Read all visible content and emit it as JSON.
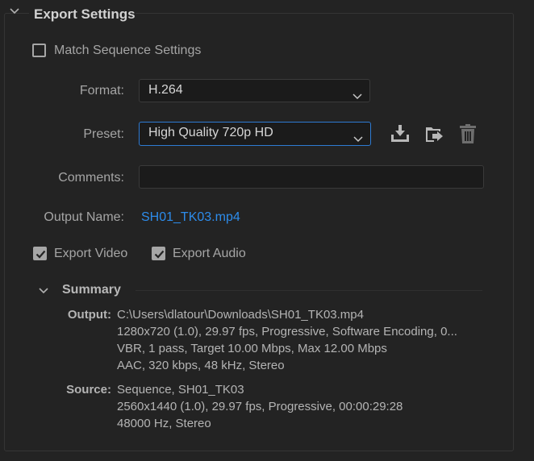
{
  "header": {
    "title": "Export Settings"
  },
  "match_sequence": {
    "label": "Match Sequence Settings",
    "checked": false
  },
  "format": {
    "label": "Format:",
    "value": "H.264"
  },
  "preset": {
    "label": "Preset:",
    "value": "High Quality 720p HD"
  },
  "preset_actions": [
    "save-preset-icon",
    "import-preset-icon",
    "delete-preset-icon"
  ],
  "comments": {
    "label": "Comments:",
    "value": ""
  },
  "output_name": {
    "label": "Output Name:",
    "value": "SH01_TK03.mp4"
  },
  "export_video": {
    "label": "Export Video",
    "checked": true
  },
  "export_audio": {
    "label": "Export Audio",
    "checked": true
  },
  "summary": {
    "title": "Summary",
    "output": {
      "label": "Output:",
      "lines": [
        "C:\\Users\\dlatour\\Downloads\\SH01_TK03.mp4",
        "1280x720 (1.0), 29.97 fps, Progressive, Software Encoding, 0...",
        "VBR, 1 pass, Target 10.00 Mbps, Max 12.00 Mbps",
        "AAC, 320 kbps, 48 kHz, Stereo"
      ]
    },
    "source": {
      "label": "Source:",
      "lines": [
        "Sequence, SH01_TK03",
        "2560x1440 (1.0), 29.97 fps, Progressive, 00:00:29:28",
        "48000 Hz, Stereo"
      ]
    }
  },
  "colors": {
    "background": "#232323",
    "accent_link": "#2d8ceb",
    "focus_border": "#2e7bd3"
  }
}
